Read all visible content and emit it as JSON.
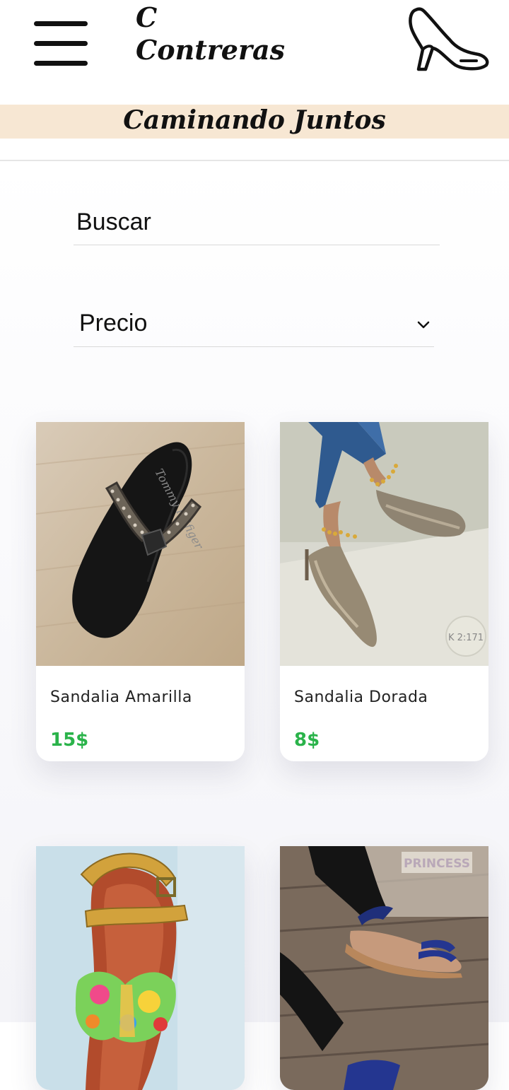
{
  "header": {
    "brand_line1": "C",
    "brand_line2": "Contreras",
    "logo_icon": "high-heel-shoe-icon",
    "menu_icon": "hamburger-menu-icon"
  },
  "tagline": "Caminando Juntos",
  "search": {
    "placeholder": "Buscar",
    "value": ""
  },
  "filter": {
    "selected": "Precio",
    "icon": "chevron-down-icon"
  },
  "colors": {
    "price_green": "#2ab34a",
    "tagline_bg": "#f7e7d3"
  },
  "products": [
    {
      "name": "Sandalia Amarilla",
      "price": "15$"
    },
    {
      "name": "Sandalia Dorada",
      "price": "8$"
    },
    {
      "name": "",
      "price": ""
    },
    {
      "name": "",
      "price": ""
    }
  ],
  "image_text": {
    "sandal_brand": "Tommy Hilfiger",
    "photo_watermark": "K 2:171",
    "princess_logo": "PRINCESS"
  }
}
